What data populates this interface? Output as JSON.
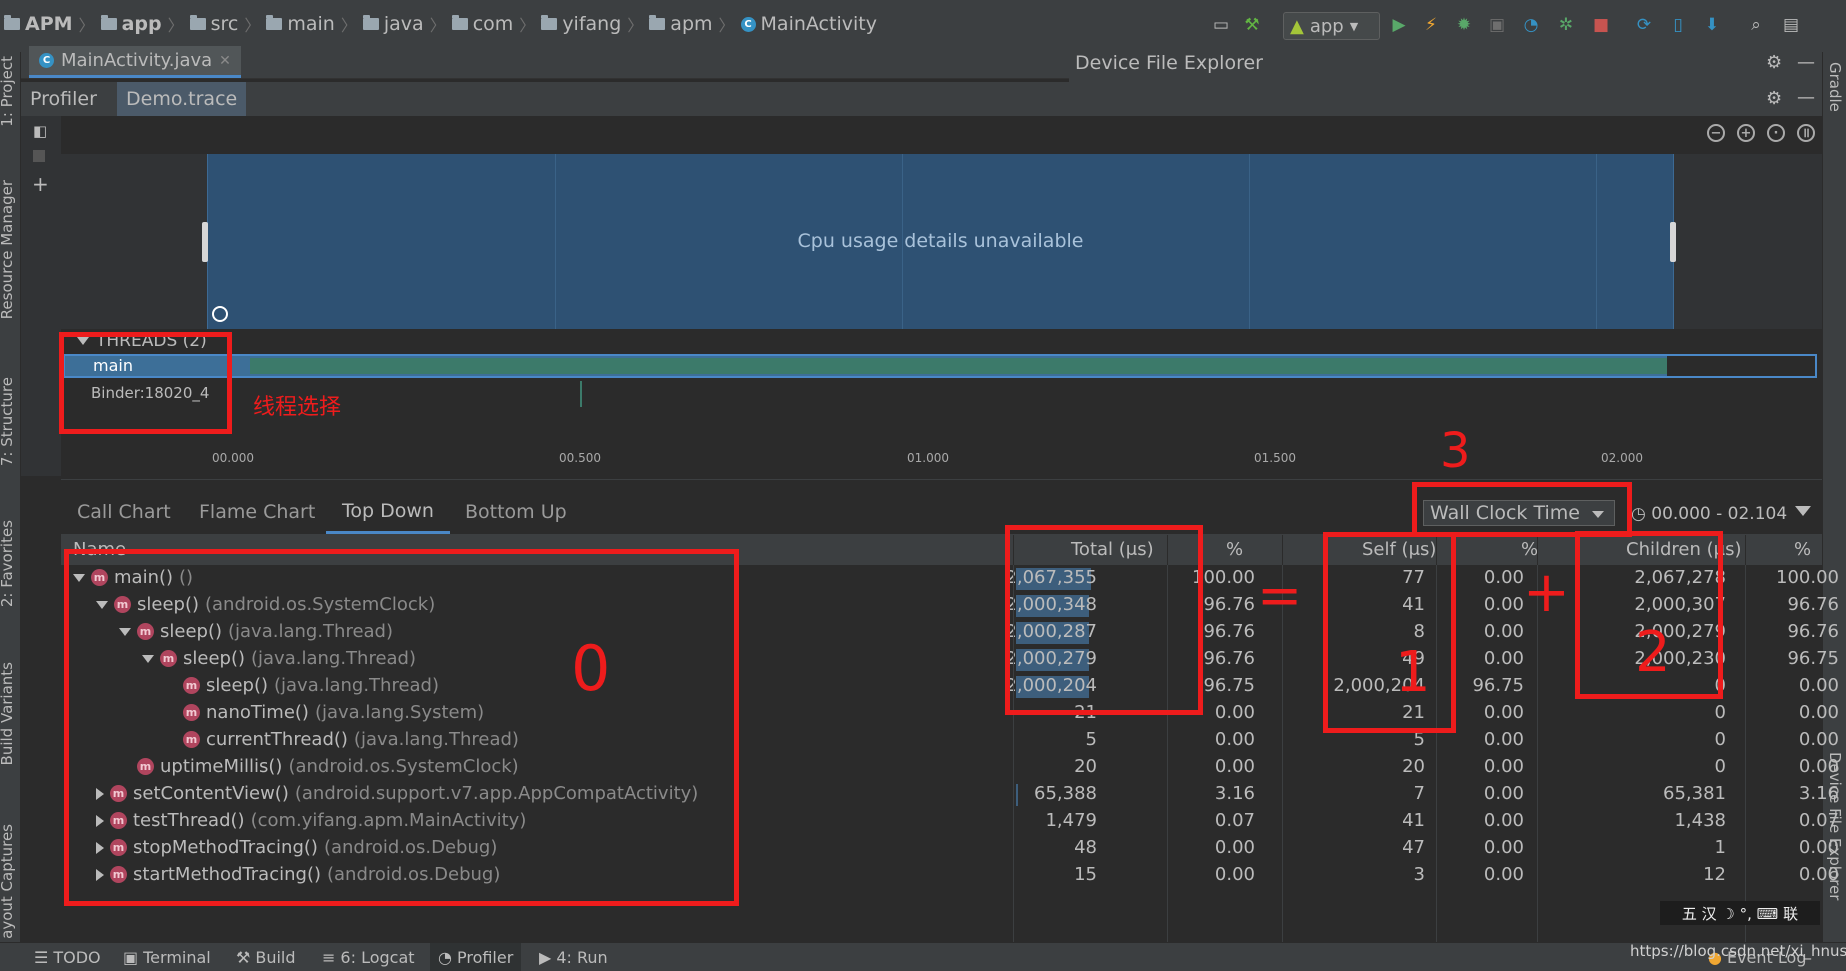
{
  "breadcrumb": [
    {
      "label": "APM",
      "icon": "module-icon"
    },
    {
      "label": "app",
      "icon": "module-icon"
    },
    {
      "label": "src",
      "icon": "folder-icon"
    },
    {
      "label": "main",
      "icon": "folder-icon"
    },
    {
      "label": "java",
      "icon": "folder-icon"
    },
    {
      "label": "com",
      "icon": "folder-icon"
    },
    {
      "label": "yifang",
      "icon": "folder-icon"
    },
    {
      "label": "apm",
      "icon": "folder-icon"
    },
    {
      "label": "MainActivity",
      "icon": "class-icon"
    }
  ],
  "toolbar": {
    "run_config": "app"
  },
  "left_tools": {
    "project": "1: Project",
    "resource_manager": "Resource Manager",
    "structure": "7: Structure",
    "favorites": "2: Favorites",
    "build_variants": "Build Variants",
    "layout_captures": "ayout Captures"
  },
  "right_tools": {
    "gradle": "Gradle",
    "device_file_explorer": "Device File Explorer"
  },
  "editor": {
    "tab": "MainActivity.java"
  },
  "device_file_explorer": {
    "title": "Device File Explorer"
  },
  "profiler": {
    "tab_profiler": "Profiler",
    "tab_trace": "Demo.trace",
    "cpu_message": "Cpu usage details unavailable",
    "threads_header": "THREADS (2)",
    "threads": [
      "main",
      "Binder:18020_4"
    ],
    "ticks": [
      "00.000",
      "00.500",
      "01.000",
      "01.500",
      "02.000"
    ]
  },
  "analysis": {
    "tabs": [
      "Call Chart",
      "Flame Chart",
      "Top Down",
      "Bottom Up"
    ],
    "active_tab": "Top Down",
    "clock": "Wall Clock Time",
    "time_range": "00.000 - 02.104"
  },
  "table": {
    "headers": {
      "name": "Name",
      "total": "Total (μs)",
      "total_pct": "%",
      "self": "Self (μs)",
      "self_pct": "%",
      "children": "Children (μs)",
      "children_pct": "%"
    },
    "rows": [
      {
        "name": "main()",
        "pkg": "()",
        "total": "2,067,355",
        "tpct": "100.00",
        "self": "77",
        "spct": "0.00",
        "children": "2,067,278",
        "cpct": "100.00",
        "bar": 1.0
      },
      {
        "name": "sleep()",
        "pkg": "(android.os.SystemClock)",
        "total": "2,000,348",
        "tpct": "96.76",
        "self": "41",
        "spct": "0.00",
        "children": "2,000,307",
        "cpct": "96.76",
        "bar": 0.9676
      },
      {
        "name": "sleep()",
        "pkg": "(java.lang.Thread)",
        "total": "2,000,287",
        "tpct": "96.76",
        "self": "8",
        "spct": "0.00",
        "children": "2,000,279",
        "cpct": "96.76",
        "bar": 0.9676
      },
      {
        "name": "sleep()",
        "pkg": "(java.lang.Thread)",
        "total": "2,000,279",
        "tpct": "96.76",
        "self": "49",
        "spct": "0.00",
        "children": "2,000,230",
        "cpct": "96.75",
        "bar": 0.9676
      },
      {
        "name": "sleep()",
        "pkg": "(java.lang.Thread)",
        "total": "2,000,204",
        "tpct": "96.75",
        "self": "2,000,204",
        "spct": "96.75",
        "children": "0",
        "cpct": "0.00",
        "bar": 0.9675
      },
      {
        "name": "nanoTime()",
        "pkg": "(java.lang.System)",
        "total": "21",
        "tpct": "0.00",
        "self": "21",
        "spct": "0.00",
        "children": "0",
        "cpct": "0.00",
        "bar": 0
      },
      {
        "name": "currentThread()",
        "pkg": "(java.lang.Thread)",
        "total": "5",
        "tpct": "0.00",
        "self": "5",
        "spct": "0.00",
        "children": "0",
        "cpct": "0.00",
        "bar": 0
      },
      {
        "name": "uptimeMillis()",
        "pkg": "(android.os.SystemClock)",
        "total": "20",
        "tpct": "0.00",
        "self": "20",
        "spct": "0.00",
        "children": "0",
        "cpct": "0.00",
        "bar": 0
      },
      {
        "name": "setContentView()",
        "pkg": "(android.support.v7.app.AppCompatActivity)",
        "total": "65,388",
        "tpct": "3.16",
        "self": "7",
        "spct": "0.00",
        "children": "65,381",
        "cpct": "3.16",
        "bar": 0.0316
      },
      {
        "name": "testThread()",
        "pkg": "(com.yifang.apm.MainActivity)",
        "total": "1,479",
        "tpct": "0.07",
        "self": "41",
        "spct": "0.00",
        "children": "1,438",
        "cpct": "0.07",
        "bar": 0
      },
      {
        "name": "stopMethodTracing()",
        "pkg": "(android.os.Debug)",
        "total": "48",
        "tpct": "0.00",
        "self": "47",
        "spct": "0.00",
        "children": "1",
        "cpct": "0.00",
        "bar": 0
      },
      {
        "name": "startMethodTracing()",
        "pkg": "(android.os.Debug)",
        "total": "15",
        "tpct": "0.00",
        "self": "3",
        "spct": "0.00",
        "children": "12",
        "cpct": "0.00",
        "bar": 0
      }
    ]
  },
  "statusbar": {
    "todo": "TODO",
    "terminal": "Terminal",
    "build": "Build",
    "logcat": "6: Logcat",
    "profiler": "Profiler",
    "run": "4: Run",
    "event_log": "Event Log"
  },
  "watermark": "https://blog.csdn.net/xi_hnust",
  "ime": "五 汉 ☽ °, ⌨ 联",
  "annotations": {
    "thread_select": "线程选择",
    "n0": "0",
    "n1": "1",
    "n2": "2",
    "n3": "3",
    "eq": "=",
    "plus": "+"
  }
}
